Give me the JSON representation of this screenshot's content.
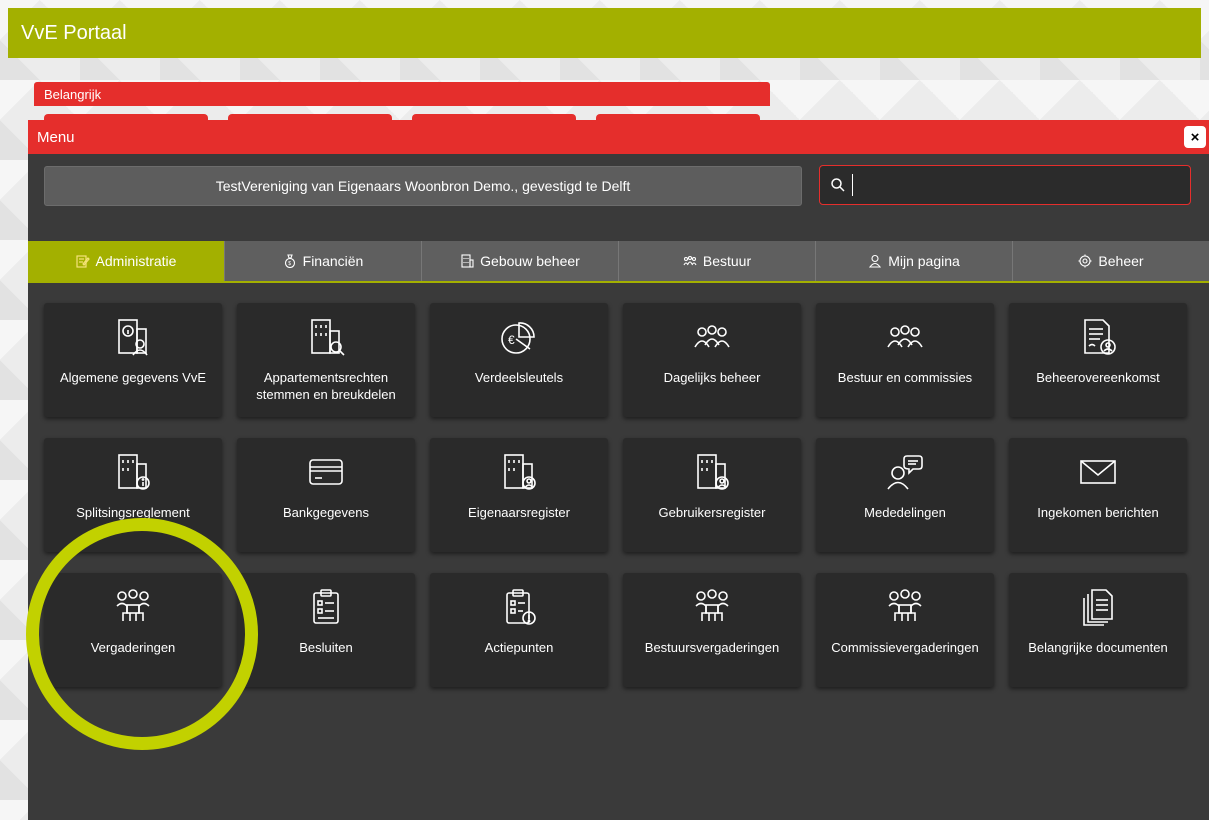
{
  "app": {
    "title": "VvE Portaal"
  },
  "notice": {
    "label": "Belangrijk"
  },
  "menu": {
    "title": "Menu",
    "close_label": "×",
    "organization": "TestVereniging van Eigenaars Woonbron Demo., gevestigd te Delft",
    "search": {
      "value": "",
      "placeholder": ""
    }
  },
  "tabs": [
    {
      "label": "Administratie",
      "icon": "edit-icon",
      "active": true
    },
    {
      "label": "Financiën",
      "icon": "money-bag-icon",
      "active": false
    },
    {
      "label": "Gebouw beheer",
      "icon": "building-icon",
      "active": false
    },
    {
      "label": "Bestuur",
      "icon": "group-icon",
      "active": false
    },
    {
      "label": "Mijn pagina",
      "icon": "user-icon",
      "active": false
    },
    {
      "label": "Beheer",
      "icon": "gear-icon",
      "active": false
    }
  ],
  "tiles": [
    {
      "label": "Algemene gegevens VvE",
      "icon": "building-info-user-icon"
    },
    {
      "label": "Appartementsrechten stemmen en breukdelen",
      "icon": "building-search-icon"
    },
    {
      "label": "Verdeelsleutels",
      "icon": "euro-pie-chart-icon"
    },
    {
      "label": "Dagelijks beheer",
      "icon": "people-group-icon"
    },
    {
      "label": "Bestuur en commissies",
      "icon": "people-group-icon"
    },
    {
      "label": "Beheerovereenkomst",
      "icon": "contract-user-icon"
    },
    {
      "label": "Splitsingsreglement",
      "icon": "building-info-icon"
    },
    {
      "label": "Bankgegevens",
      "icon": "credit-card-icon"
    },
    {
      "label": "Eigenaarsregister",
      "icon": "building-user-icon"
    },
    {
      "label": "Gebruikersregister",
      "icon": "building-user-icon"
    },
    {
      "label": "Mededelingen",
      "icon": "person-speech-icon"
    },
    {
      "label": "Ingekomen berichten",
      "icon": "envelope-icon"
    },
    {
      "label": "Vergaderingen",
      "icon": "meeting-icon"
    },
    {
      "label": "Besluiten",
      "icon": "clipboard-icon"
    },
    {
      "label": "Actiepunten",
      "icon": "clipboard-alert-icon"
    },
    {
      "label": "Bestuursvergaderingen",
      "icon": "meeting-icon"
    },
    {
      "label": "Commissievergaderingen",
      "icon": "meeting-icon"
    },
    {
      "label": "Belangrijke documenten",
      "icon": "documents-icon"
    }
  ],
  "colors": {
    "accent": "#a3b000",
    "header_red": "#e52e2c",
    "panel": "#3a3a3a",
    "tile": "#2a2a2a",
    "highlight": "#c2d100"
  }
}
